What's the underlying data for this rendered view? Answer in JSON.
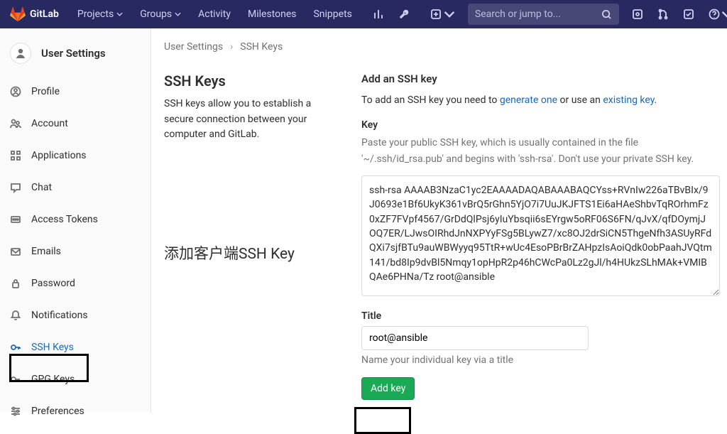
{
  "header": {
    "brand": "GitLab",
    "projects": "Projects",
    "groups": "Groups",
    "activity": "Activity",
    "milestones": "Milestones",
    "snippets": "Snippets",
    "search_placeholder": "Search or jump to..."
  },
  "sidebar": {
    "title": "User Settings",
    "items": [
      {
        "label": "Profile"
      },
      {
        "label": "Account"
      },
      {
        "label": "Applications"
      },
      {
        "label": "Chat"
      },
      {
        "label": "Access Tokens"
      },
      {
        "label": "Emails"
      },
      {
        "label": "Password"
      },
      {
        "label": "Notifications"
      },
      {
        "label": "SSH Keys"
      },
      {
        "label": "GPG Keys"
      },
      {
        "label": "Preferences"
      }
    ]
  },
  "breadcrumb": {
    "root": "User Settings",
    "page": "SSH Keys"
  },
  "left": {
    "heading": "SSH Keys",
    "desc": "SSH keys allow you to establish a secure connection between your computer and GitLab.",
    "annotation": "添加客户端SSH Key"
  },
  "right": {
    "add_heading": "Add an SSH key",
    "help_pre": "To add an SSH key you need to ",
    "link1": "generate one",
    "help_mid": " or use an ",
    "link2": "existing key",
    "help_end": ".",
    "key_label": "Key",
    "key_help": "Paste your public SSH key, which is usually contained in the file '~/.ssh/id_rsa.pub' and begins with 'ssh-rsa'. Don't use your private SSH key.",
    "key_value": "ssh-rsa AAAAB3NzaC1yc2EAAAADAQABAAABAQCYss+RVnIw226aTBvBIx/9J0693e1Bf6UkyK361vBrQ5rGhn5YjO7i7UuJKJFTS1Ei6aHAeShbvTqROrhmFz0xZF7FVpf4567/GrDdQlPsj6yIuYbsqii6sEYrgw5oRF06S6FN/qJvX/qfDOymjJOQ7ER/LJwsOIRhdJnNXPYyFSg5BLywZ7/xc8OJ2drSiCN5ThgeNfh3ASUyRFdQXi7sjfBTu9auWBWyyq95TtR+wUc4EsoPBrBrZAHpzIsAoiQdk0obPaahJVQtm141/bd8Ip9dvBl5Nmqy1opHpR2p46hCWcPa0Lz2gJl/h4HUkzSLhMAk+VMIBQAe6PHNa/Tz root@ansible",
    "title_label": "Title",
    "title_value": "root@ansible",
    "title_hint": "Name your individual key via a title",
    "addkey_label": "Add key"
  }
}
